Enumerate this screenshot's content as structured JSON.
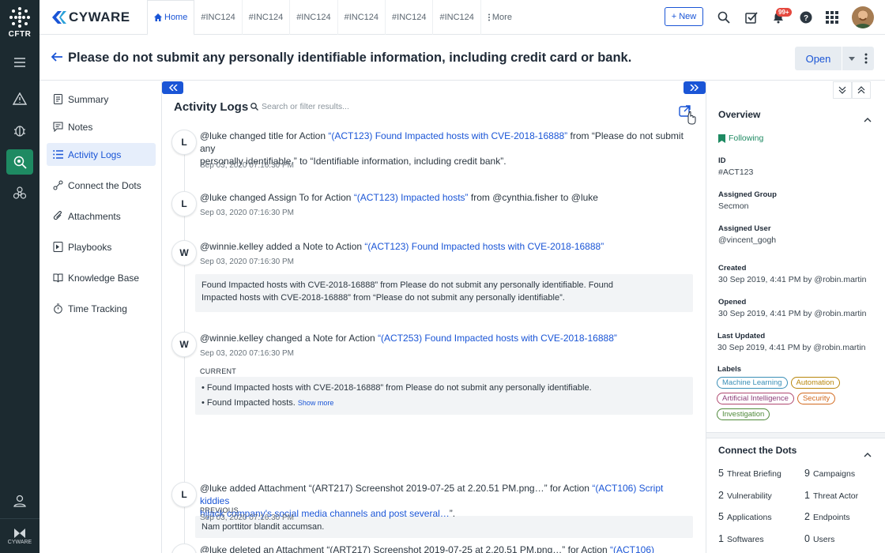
{
  "app": {
    "rail_label": "CFTR",
    "brand": "CYWARE",
    "rail_brand": "CYWARE"
  },
  "tabs": [
    {
      "label": "Home"
    },
    {
      "label": "#INC124"
    },
    {
      "label": "#INC124"
    },
    {
      "label": "#INC124"
    },
    {
      "label": "#INC124"
    },
    {
      "label": "#INC124"
    },
    {
      "label": "#INC124"
    },
    {
      "label": "More"
    }
  ],
  "toolbar": {
    "new_label": "+ New",
    "notif_count": "99+"
  },
  "page": {
    "title": "Please do not submit any personally identifiable information, including credit card or bank.",
    "status": "Open"
  },
  "nav": [
    {
      "label": "Summary"
    },
    {
      "label": "Notes"
    },
    {
      "label": "Activity Logs"
    },
    {
      "label": "Connect the Dots"
    },
    {
      "label": "Attachments"
    },
    {
      "label": "Playbooks"
    },
    {
      "label": "Knowledge Base"
    },
    {
      "label": "Time Tracking"
    }
  ],
  "activity": {
    "heading": "Activity Logs",
    "search_placeholder": "Search or filter results...",
    "entries": [
      {
        "initial": "L",
        "user": "@luke",
        "verb": "changed",
        "field": "title",
        "for": "for",
        "obj": "Action",
        "link": "“(ACT123) Found Impacted hosts with CVE-2018-16888”",
        "from": "from",
        "from_val": "“Please do not submit any",
        "line2": "personally identifiable ” to “Identifiable information, including credit bank”.",
        "time": "Sep 03, 2020 07:16:30 PM"
      },
      {
        "initial": "L",
        "user": "@luke",
        "verb": "changed",
        "field": "Assign To",
        "for": "for",
        "obj": "Action",
        "link": "“(ACT123) Impacted hosts”",
        "from": "from @cynthia.fisher to @luke",
        "time": "Sep 03, 2020 07:16:30 PM"
      },
      {
        "initial": "W",
        "user": "@winnie.kelley",
        "verb": "added a",
        "field": "Note",
        "for": "to",
        "obj": "Action",
        "link": "“(ACT123) Found Impacted hosts with CVE-2018-16888”",
        "time": "Sep 03, 2020 07:16:30 PM",
        "note1": "Found Impacted hosts with CVE-2018-16888” from Please do not submit any personally identifiable. Found",
        "note2": "Impacted hosts with CVE-2018-16888” from “Please do not submit any personally identifiable”."
      },
      {
        "initial": "W",
        "user": "@winnie.kelley",
        "verb": "changed a",
        "field": "Note",
        "for": "for",
        "obj": "Action",
        "link": "“(ACT253) Found Impacted hosts with CVE-2018-16888”",
        "time": "Sep 03, 2020 07:16:30 PM",
        "current_label": "CURRENT",
        "bullet1": "Found Impacted hosts with CVE-2018-16888” from Please do not submit any personally identifiable.",
        "bullet2": "Found Impacted hosts.",
        "show_more": "Show more",
        "previous_label": "PREVIOUS",
        "previous": "Nam porttitor blandit accumsan."
      },
      {
        "initial": "L",
        "user": "@luke",
        "verb": "added",
        "field": "Attachment",
        "att": "“(ART217) Screenshot 2019-07-25 at 2.20.51 PM.png…”",
        "for": "for",
        "obj": "Action",
        "link": "“(ACT106) Script kiddies",
        "link2": "hijack company's social media channels and post several…",
        "tail": "”.",
        "time": "Sep 03, 2020 07:16:30 PM"
      },
      {
        "user": "@luke",
        "verb": "deleted an",
        "field": "Attachment",
        "att": "“(ART217) Screenshot 2019-07-25 at 2.20.51 PM.png…”",
        "for": "for",
        "obj": "Action",
        "link": "“(ACT106)"
      }
    ]
  },
  "overview": {
    "heading": "Overview",
    "following": "Following",
    "fields": [
      {
        "label": "ID",
        "value": "#ACT123"
      },
      {
        "label": "Assigned Group",
        "value": "Secmon"
      },
      {
        "label": "Assigned User",
        "value": "@vincent_gogh"
      },
      {
        "label": "Created",
        "value": "30 Sep 2019, 4:41 PM by @robin.martin"
      },
      {
        "label": "Opened",
        "value": "30 Sep 2019, 4:41 PM by @robin.martin"
      },
      {
        "label": "Last Updated",
        "value": "30 Sep 2019, 4:41 PM by @robin.martin"
      }
    ],
    "labels_heading": "Labels",
    "labels": [
      {
        "text": "Machine Learning",
        "color": "#3a8fb7"
      },
      {
        "text": "Automation",
        "color": "#b8860b"
      },
      {
        "text": "Artificial Intelligence",
        "color": "#8e3f7a"
      },
      {
        "text": "Security",
        "color": "#d2691e"
      },
      {
        "text": "Investigation",
        "color": "#4f8a3a"
      }
    ]
  },
  "ctd": {
    "heading": "Connect the Dots",
    "items": [
      {
        "count": "5",
        "label": "Threat Briefing"
      },
      {
        "count": "9",
        "label": "Campaigns"
      },
      {
        "count": "2",
        "label": "Vulnerability"
      },
      {
        "count": "1",
        "label": "Threat Actor"
      },
      {
        "count": "5",
        "label": "Applications"
      },
      {
        "count": "2",
        "label": "Endpoints"
      },
      {
        "count": "1",
        "label": "Softwares"
      },
      {
        "count": "0",
        "label": "Users"
      }
    ]
  },
  "colors": {
    "accent": "#1a55d6",
    "rail": "#1c2a30",
    "active_green": "#1e8a62"
  }
}
